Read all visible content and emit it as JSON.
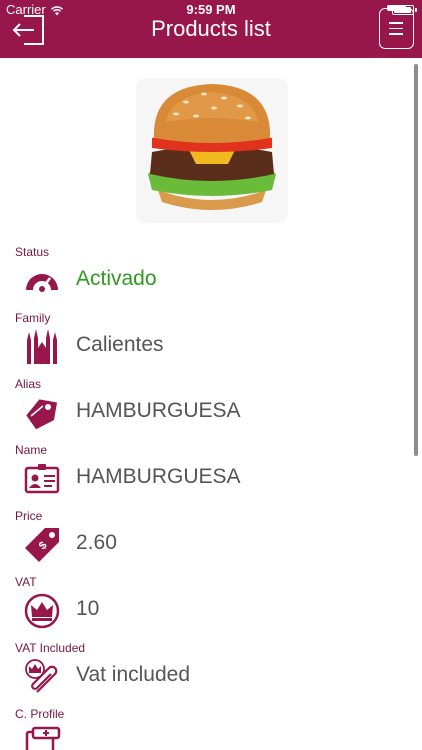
{
  "statusbar": {
    "carrier": "Carrier",
    "time": "9:59 PM",
    "battery_level": 0.95
  },
  "navbar": {
    "title": "Products list",
    "back_icon": "logout-arrow-icon",
    "menu_icon": "clipboard-list-icon"
  },
  "colors": {
    "brand": "#97174a",
    "label": "#7a1540",
    "active": "#2f9a1f",
    "value": "#555555"
  },
  "product": {
    "image": "hamburger-photo"
  },
  "fields": [
    {
      "label": "Status",
      "value": "Activado",
      "icon": "gauge-icon"
    },
    {
      "label": "Family",
      "value": "Calientes",
      "icon": "cathedral-icon"
    },
    {
      "label": "Alias",
      "value": "HAMBURGUESA",
      "icon": "tag-icon"
    },
    {
      "label": "Name",
      "value": "HAMBURGUESA",
      "icon": "id-card-icon"
    },
    {
      "label": "Price",
      "value": "2.60",
      "icon": "price-tag-icon"
    },
    {
      "label": "VAT",
      "value": "10",
      "icon": "crown-icon"
    },
    {
      "label": "VAT Included",
      "value": "Vat included",
      "icon": "crown-paperclip-icon"
    },
    {
      "label": "C. Profile",
      "value": "",
      "icon": "profile-list-icon"
    }
  ]
}
